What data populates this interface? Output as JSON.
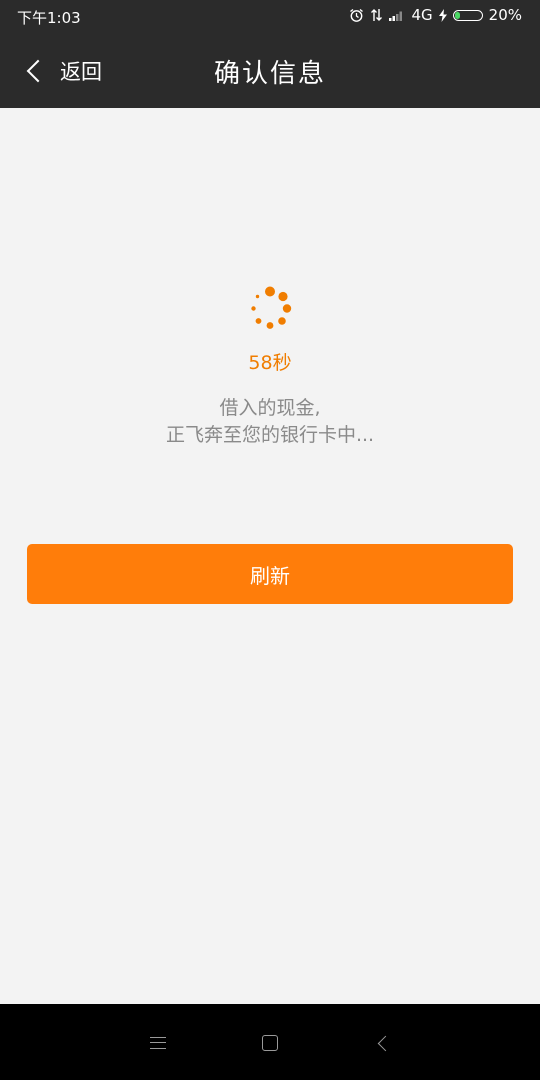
{
  "status_bar": {
    "time": "下午1:03",
    "network": "4G",
    "battery": "20%",
    "battery_level": 0.2,
    "icons": [
      "alarm-icon",
      "data-transfer-icon",
      "signal-icon",
      "charging-icon",
      "battery-icon"
    ]
  },
  "header": {
    "back_label": "返回",
    "title": "确认信息"
  },
  "main": {
    "countdown": "58秒",
    "message_line1": "借入的现金,",
    "message_line2": "正飞奔至您的银行卡中...",
    "refresh_label": "刷新"
  },
  "nav_bar": {
    "icons": [
      "menu-icon",
      "home-icon",
      "back-icon"
    ]
  },
  "colors": {
    "accent": "#ff7d0a",
    "header_bg": "#2b2b2b",
    "page_bg": "#f3f3f3",
    "text_secondary": "#8a8a8a"
  }
}
